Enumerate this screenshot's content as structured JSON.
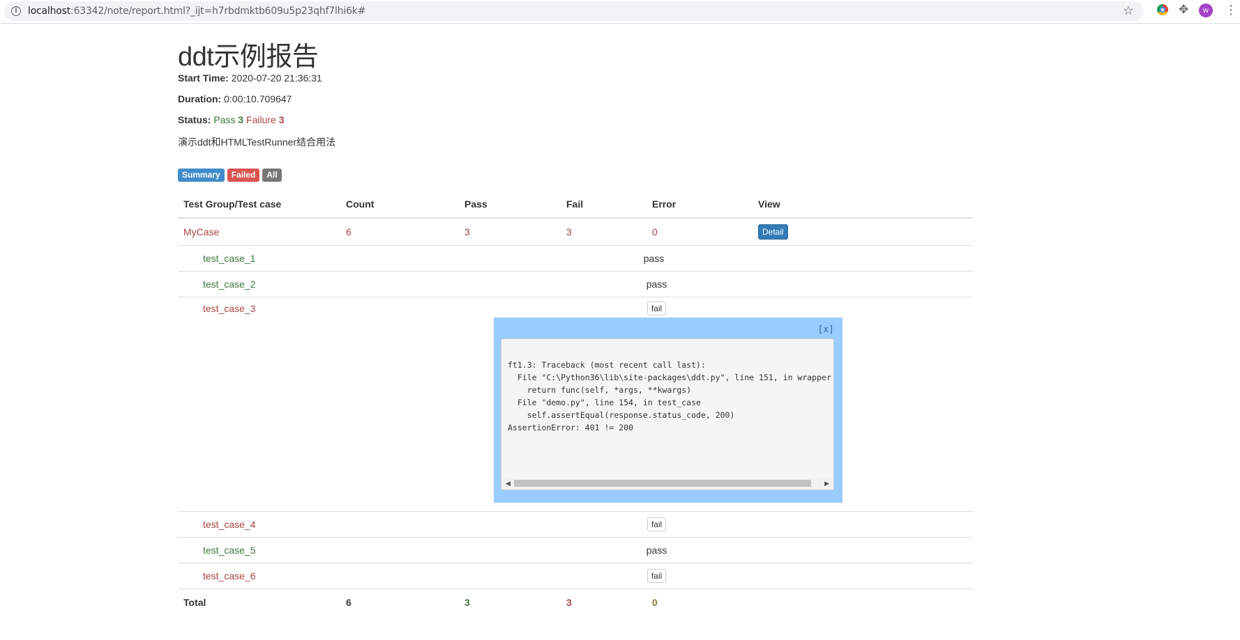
{
  "browser": {
    "url_host": "localhost",
    "url_rest": ":63342/note/report.html?_ijt=h7rbdmktb609u5p23qhf7lhi6k#",
    "avatar_initial": "w"
  },
  "report": {
    "title": "ddt示例报告",
    "start_time_label": "Start Time:",
    "start_time": "2020-07-20 21:36:31",
    "duration_label": "Duration:",
    "duration": "0:00:10.709647",
    "status_label": "Status:",
    "status_pass_label": "Pass",
    "status_pass_count": "3",
    "status_fail_label": "Failure",
    "status_fail_count": "3",
    "description": "演示ddt和HTMLTestRunner结合用法"
  },
  "filters": {
    "summary": "Summary",
    "failed": "Failed",
    "all": "All"
  },
  "table": {
    "headers": [
      "Test Group/Test case",
      "Count",
      "Pass",
      "Fail",
      "Error",
      "View"
    ],
    "group": {
      "name": "MyCase",
      "count": "6",
      "pass": "3",
      "fail": "3",
      "error": "0",
      "view": "Detail"
    },
    "cases": [
      {
        "name": "test_case_1",
        "status": "pass"
      },
      {
        "name": "test_case_2",
        "status": "pass"
      },
      {
        "name": "test_case_3",
        "status": "fail"
      },
      {
        "name": "test_case_4",
        "status": "fail"
      },
      {
        "name": "test_case_5",
        "status": "pass"
      },
      {
        "name": "test_case_6",
        "status": "fail"
      }
    ],
    "total": {
      "label": "Total",
      "count": "6",
      "pass": "3",
      "fail": "3",
      "error": "0"
    }
  },
  "popup": {
    "close": "[x]",
    "traceback": "ft1.3: Traceback (most recent call last):\n  File \"C:\\Python36\\lib\\site-packages\\ddt.py\", line 151, in wrapper\n    return func(self, *args, **kwargs)\n  File \"demo.py\", line 154, in test_case\n    self.assertEqual(response.status_code, 200)\nAssertionError: 401 != 200"
  }
}
